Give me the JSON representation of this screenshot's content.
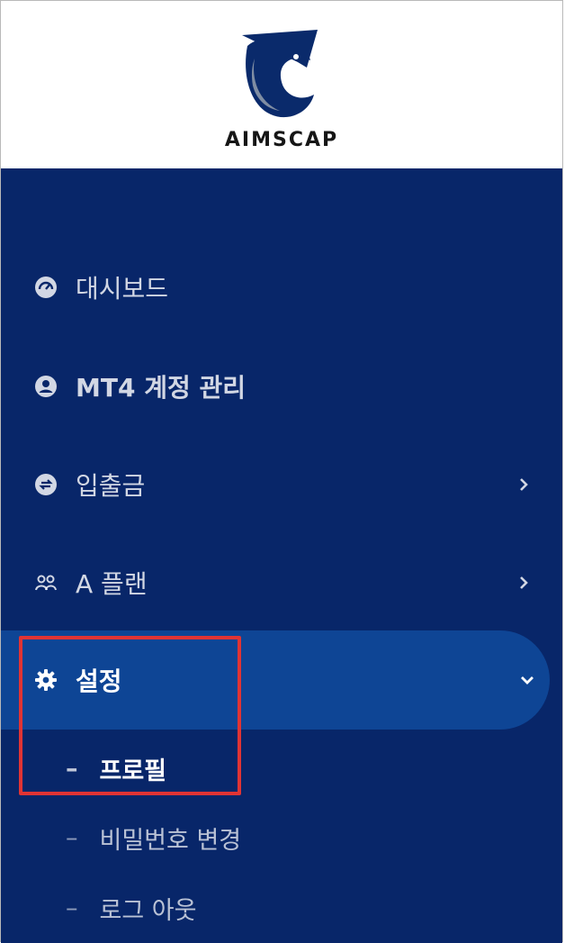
{
  "brand": {
    "name": "AIMSCAP"
  },
  "menu": {
    "items": [
      {
        "label": "대시보드",
        "icon": "dashboard-gauge-icon"
      },
      {
        "label": "MT4 계정 관리",
        "icon": "user-circle-icon"
      },
      {
        "label": "입출금",
        "icon": "exchange-circle-icon",
        "chevron": "chevron-right-icon"
      },
      {
        "label": "A 플랜",
        "icon": "users-icon",
        "chevron": "chevron-right-icon"
      },
      {
        "label": "설정",
        "icon": "gear-icon",
        "chevron": "chevron-down-icon",
        "active": true
      }
    ],
    "settings_submenu": [
      {
        "dash": "–",
        "label": "프로필",
        "current": true
      },
      {
        "dash": "–",
        "label": "비밀번호 변경"
      },
      {
        "dash": "–",
        "label": "로그 아웃"
      }
    ]
  },
  "colors": {
    "sidebar_bg": "#082669",
    "active_bg": "#0e4595",
    "highlight": "#e03434"
  }
}
